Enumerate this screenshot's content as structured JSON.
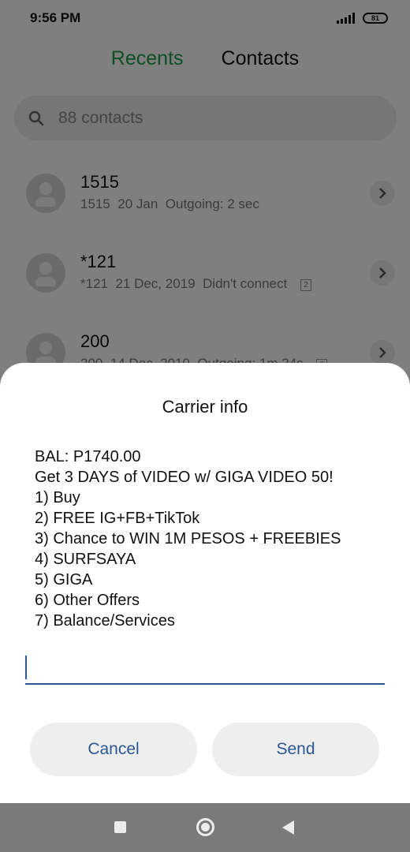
{
  "status_bar": {
    "time": "9:56 PM",
    "battery": "81"
  },
  "tabs": [
    {
      "label": "Recents",
      "active": true
    },
    {
      "label": "Contacts",
      "active": false
    }
  ],
  "search": {
    "placeholder": "88 contacts"
  },
  "calls": [
    {
      "name": "1515",
      "number": "1515",
      "date": "20 Jan",
      "status": "Outgoing: 2 sec",
      "sim": ""
    },
    {
      "name": "*121",
      "number": "*121",
      "date": "21 Dec, 2019",
      "status": "Didn't connect",
      "sim": "2"
    },
    {
      "name": "200",
      "number": "200",
      "date": "14 Dec, 2019",
      "status": "Outgoing: 1m 24s",
      "sim": "2"
    }
  ],
  "dialog": {
    "title": "Carrier info",
    "message_lines": [
      "BAL: P1740.00",
      "Get 3 DAYS of VIDEO w/ GIGA VIDEO 50!",
      "1) Buy",
      "2) FREE IG+FB+TikTok",
      "3) Chance to WIN 1M PESOS + FREEBIES",
      "4) SURFSAYA",
      "5) GIGA",
      "6) Other Offers",
      "7) Balance/Services"
    ],
    "input_value": "",
    "cancel_label": "Cancel",
    "send_label": "Send"
  },
  "colors": {
    "accent_green": "#1e9e4a",
    "button_text_blue": "#2b5797"
  },
  "icons": {
    "search": "search-icon",
    "avatar": "person-icon",
    "detail": "chevron-right-icon",
    "nav_recents": "square-icon",
    "nav_home": "circle-icon",
    "nav_back": "triangle-back-icon"
  }
}
